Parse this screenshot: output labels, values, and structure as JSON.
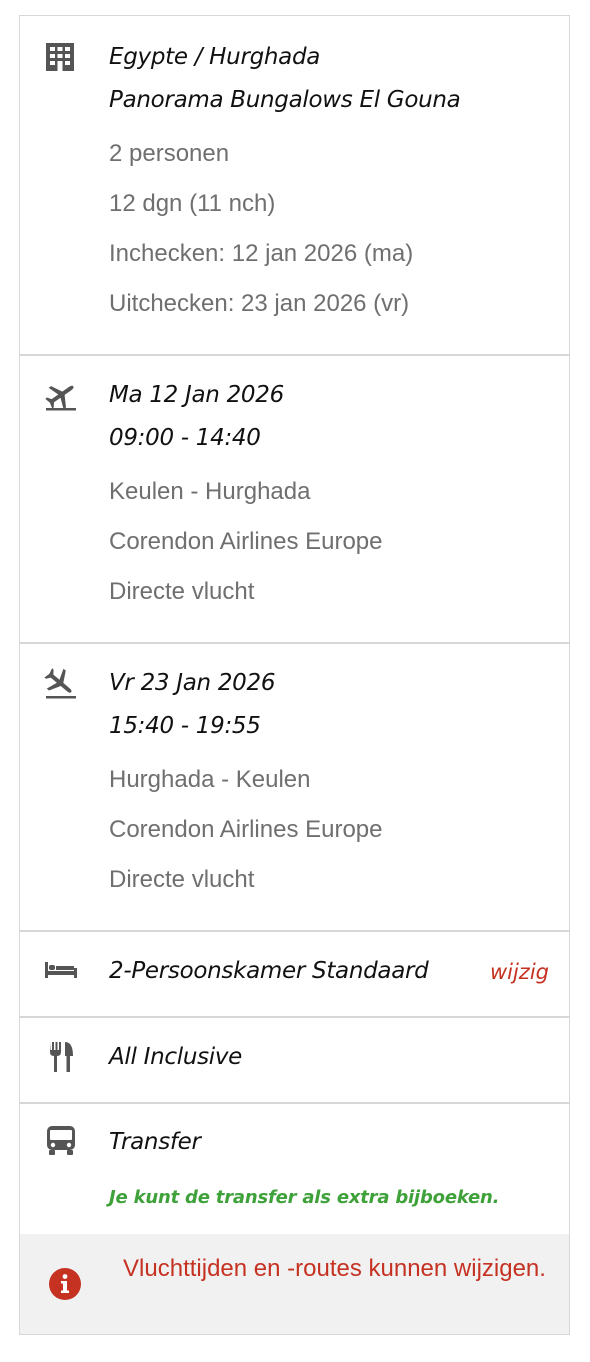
{
  "accommodation": {
    "destination": "Egypte / Hurghada",
    "hotel": "Panorama Bungalows El Gouna",
    "persons": "2 personen",
    "duration": "12 dgn (11 nch)",
    "checkin": "Inchecken: 12 jan 2026 (ma)",
    "checkout": "Uitchecken: 23 jan 2026 (vr)",
    "icon": "building-icon"
  },
  "outbound_flight": {
    "date": "Ma 12 Jan 2026",
    "time": "09:00 - 14:40",
    "route": "Keulen - Hurghada",
    "airline": "Corendon Airlines Europe",
    "type": "Directe vlucht",
    "icon": "plane-departure-icon"
  },
  "return_flight": {
    "date": "Vr 23 Jan 2026",
    "time": "15:40 - 19:55",
    "route": "Hurghada - Keulen",
    "airline": "Corendon Airlines Europe",
    "type": "Directe vlucht",
    "icon": "plane-arrival-icon"
  },
  "room": {
    "label": "2-Persoonskamer Standaard",
    "change_link": "wijzig",
    "icon": "bed-icon"
  },
  "board": {
    "label": "All Inclusive",
    "icon": "cutlery-icon"
  },
  "transfer": {
    "label": "Transfer",
    "note": "Je kunt de transfer als extra bijboeken.",
    "icon": "bus-icon"
  },
  "notice": {
    "text": "Vluchttijden en -routes kunnen wijzigen.",
    "icon": "info-icon"
  },
  "colors": {
    "accent_red": "#c53222",
    "success_green": "#3fa13a",
    "icon_gray": "#555555",
    "meta_gray": "#6f6f6f"
  }
}
